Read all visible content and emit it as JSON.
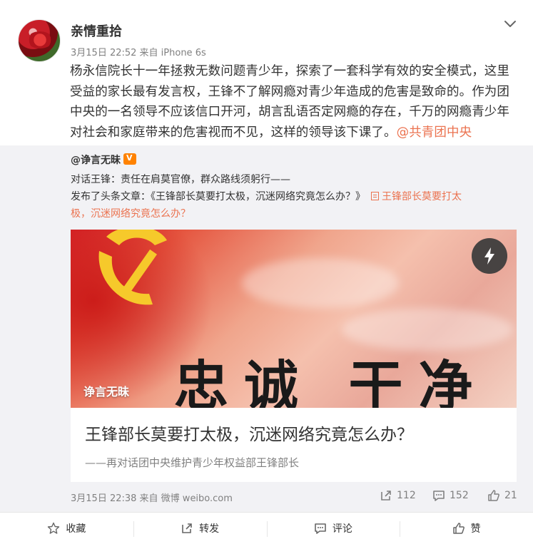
{
  "post": {
    "username": "亲情重拾",
    "meta": "3月15日 22:52 来自 iPhone 6s",
    "text": "杨永信院长十一年拯救无数问题青少年，探索了一套科学有效的安全模式，这里受益的家长最有发言权，王锋不了解网瘾对青少年造成的危害是致命的。作为团中央的一名领导不应该信口开河，胡言乱语否定网瘾的存在，千万的网瘾青少年对社会和家庭带来的危害视而不见，这样的领导该下课了。",
    "mention": "@共青团中央",
    "menu_icon": "chevron-down-icon"
  },
  "repost": {
    "username": "@诤言无昧",
    "line1": "对话王锋：责任在肩莫官僚，群众路线须躬行——",
    "line2_prefix": "发布了头条文章：《王锋部长莫要打太极，沉迷网络究竟怎么办？》",
    "article_link_a": "王锋部长莫要打太",
    "article_link_b": "极，沉迷网络究竟怎么办？",
    "card": {
      "slogan": "忠诚 干净 担",
      "watermark": "诤言无昧",
      "title": "王锋部长莫要打太极，沉迷网络究竟怎么办？",
      "subtitle": "——再对话团中央维护青少年权益部王锋部长"
    },
    "footer_time": "3月15日 22:38 来自 微博 weibo.com",
    "stats": {
      "reposts": "112",
      "comments": "152",
      "likes": "21"
    }
  },
  "actions": {
    "favorite": "收藏",
    "repost": "转发",
    "comment": "评论",
    "like": "赞"
  },
  "colors": {
    "accent": "#eb7350",
    "secondary_text": "#808080",
    "repost_bg": "#f2f2f5"
  }
}
